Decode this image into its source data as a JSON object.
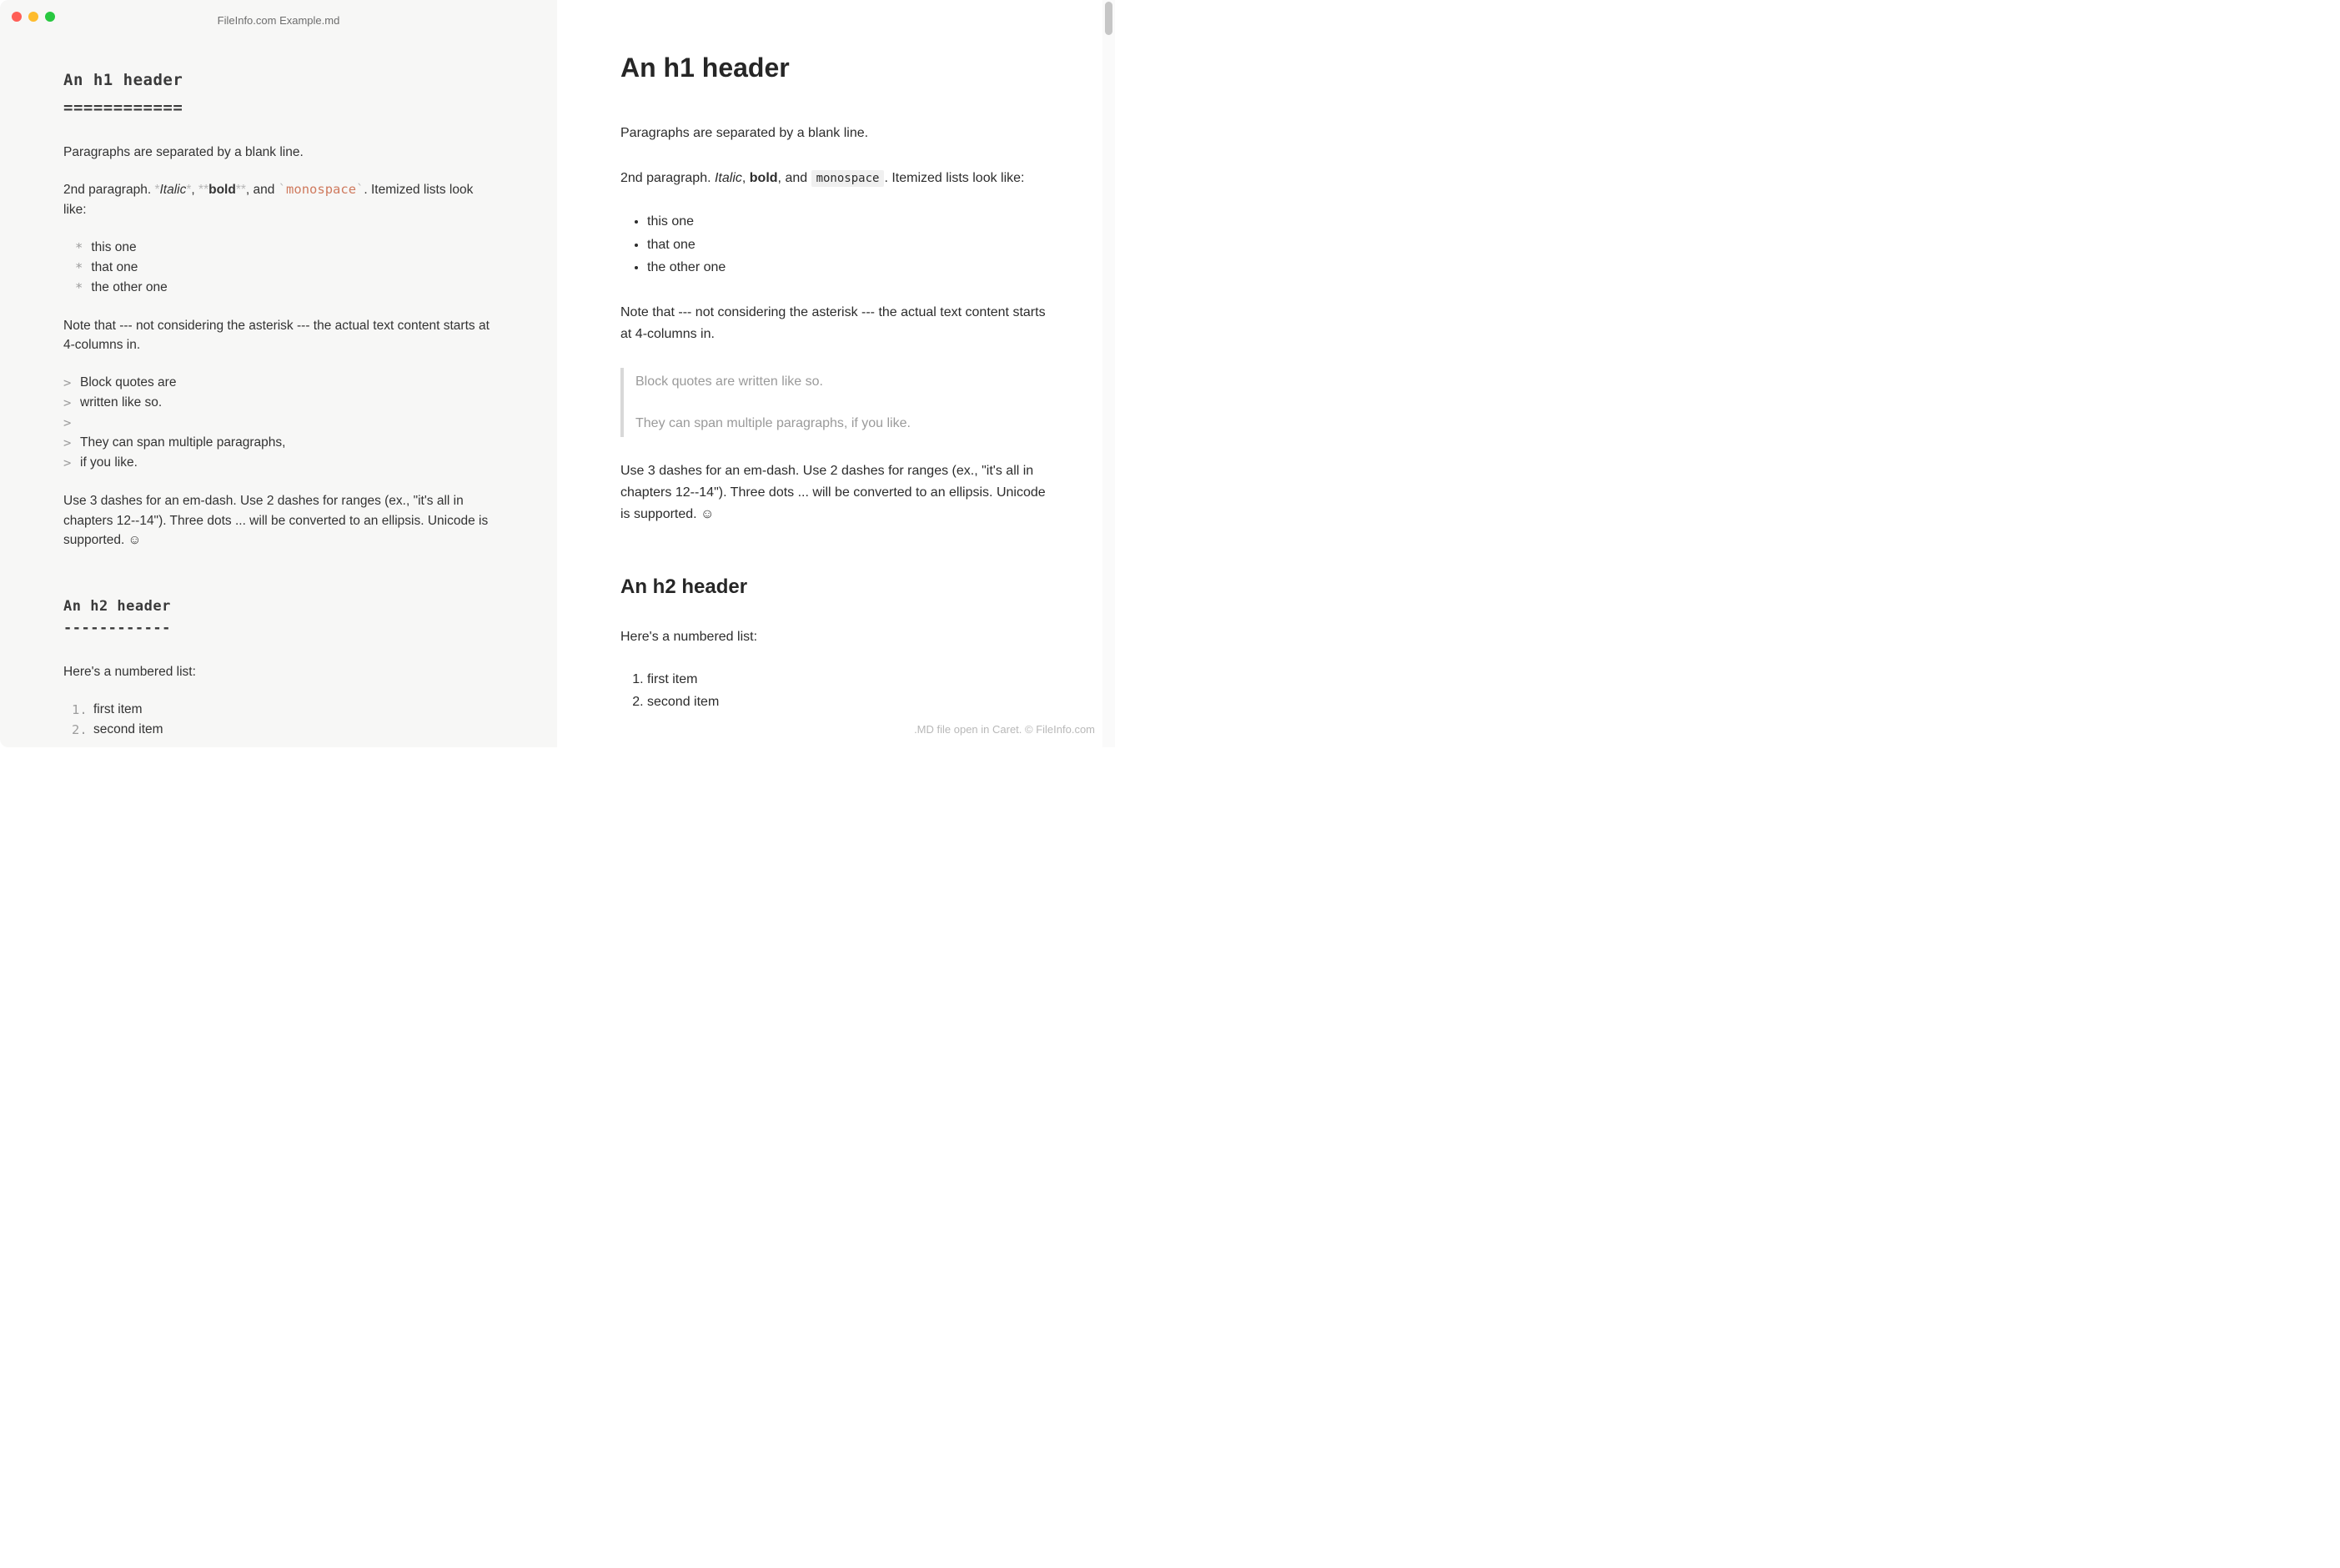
{
  "window": {
    "title": "FileInfo.com Example.md"
  },
  "source": {
    "h1": "An h1 header",
    "h1_underline": "============",
    "para1": "Paragraphs are separated by a blank line.",
    "para2_prefix": "2nd paragraph. ",
    "italic_marker": "*",
    "italic_text": "Italic",
    "bold_marker": "**",
    "bold_text": "bold",
    "code_marker": "`",
    "code_text": "monospace",
    "para2_mid1": ", ",
    "para2_mid2": ", and ",
    "para2_suffix": ". Itemized lists look like:",
    "list": [
      "this one",
      "that one",
      "the other one"
    ],
    "note": "Note that --- not considering the asterisk --- the actual text content starts at 4-columns in.",
    "quote_lines": [
      "Block quotes are",
      "written like so.",
      "",
      "They can span multiple paragraphs,",
      "if you like."
    ],
    "dashes": "Use 3 dashes for an em-dash. Use 2 dashes for ranges (ex., \"it's all in chapters 12--14\"). Three dots ... will be converted to an ellipsis. Unicode is supported. ☺",
    "h2": "An h2 header",
    "h2_underline": "------------",
    "numbered_intro": "Here's a numbered list:",
    "numbered": [
      "first item",
      "second item"
    ]
  },
  "preview": {
    "h1": "An h1 header",
    "para1": "Paragraphs are separated by a blank line.",
    "para2_prefix": "2nd paragraph. ",
    "italic_text": "Italic",
    "bold_text": "bold",
    "code_text": "monospace",
    "para2_mid1": ", ",
    "para2_mid2": ", and ",
    "para2_suffix": ". Itemized lists look like:",
    "list": [
      "this one",
      "that one",
      "the other one"
    ],
    "note": "Note that --- not considering the asterisk --- the actual text content starts at 4-columns in.",
    "quote_p1": "Block quotes are written like so.",
    "quote_p2": "They can span multiple paragraphs, if you like.",
    "dashes": "Use 3 dashes for an em-dash. Use 2 dashes for ranges (ex., \"it's all in chapters 12--14\"). Three dots ... will be converted to an ellipsis. Unicode is supported. ☺",
    "h2": "An h2 header",
    "numbered_intro": "Here's a numbered list:",
    "numbered": [
      "first item",
      "second item"
    ]
  },
  "footer": ".MD file open in Caret. © FileInfo.com"
}
